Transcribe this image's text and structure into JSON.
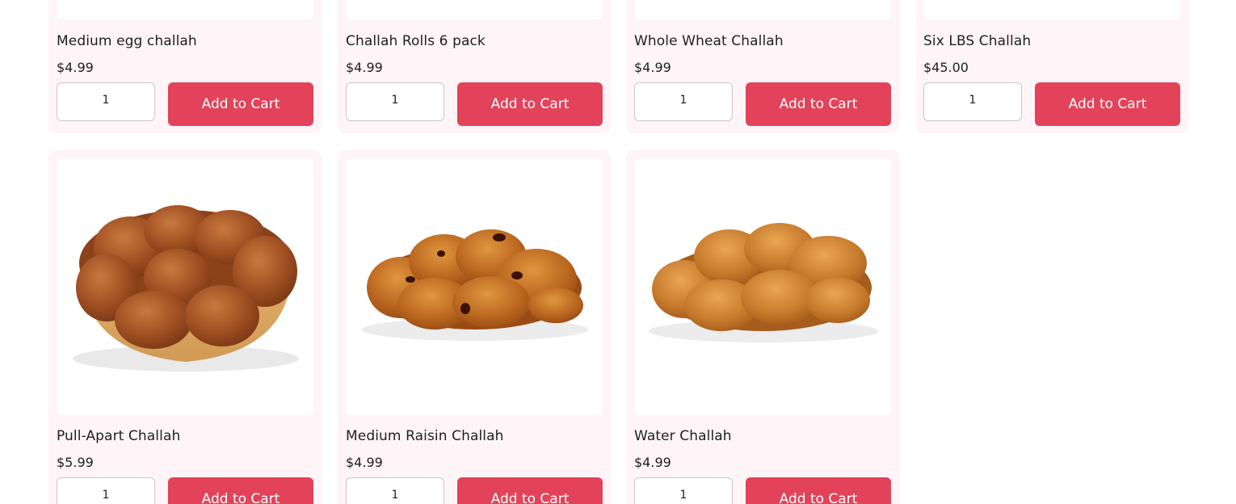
{
  "products_row1": [
    {
      "name": "Medium egg challah",
      "price": "$4.99",
      "quantity": "1",
      "button_label": "Add to Cart"
    },
    {
      "name": "Challah Rolls 6 pack",
      "price": "$4.99",
      "quantity": "1",
      "button_label": "Add to Cart"
    },
    {
      "name": "Whole Wheat Challah",
      "price": "$4.99",
      "quantity": "1",
      "button_label": "Add to Cart"
    },
    {
      "name": "Six LBS Challah",
      "price": "$45.00",
      "quantity": "1",
      "button_label": "Add to Cart"
    }
  ],
  "products_row2": [
    {
      "name": "Pull-Apart Challah",
      "price": "$5.99",
      "quantity": "1",
      "button_label": "Add to Cart",
      "image": "pull-apart-challah-photo"
    },
    {
      "name": "Medium Raisin Challah",
      "price": "$4.99",
      "quantity": "1",
      "button_label": "Add to Cart",
      "image": "raisin-challah-photo"
    },
    {
      "name": "Water Challah",
      "price": "$4.99",
      "quantity": "1",
      "button_label": "Add to Cart",
      "image": "water-challah-photo"
    }
  ],
  "colors": {
    "card_background": "#fff4f7",
    "button_background": "#e2435a",
    "button_text": "#ffffff"
  }
}
